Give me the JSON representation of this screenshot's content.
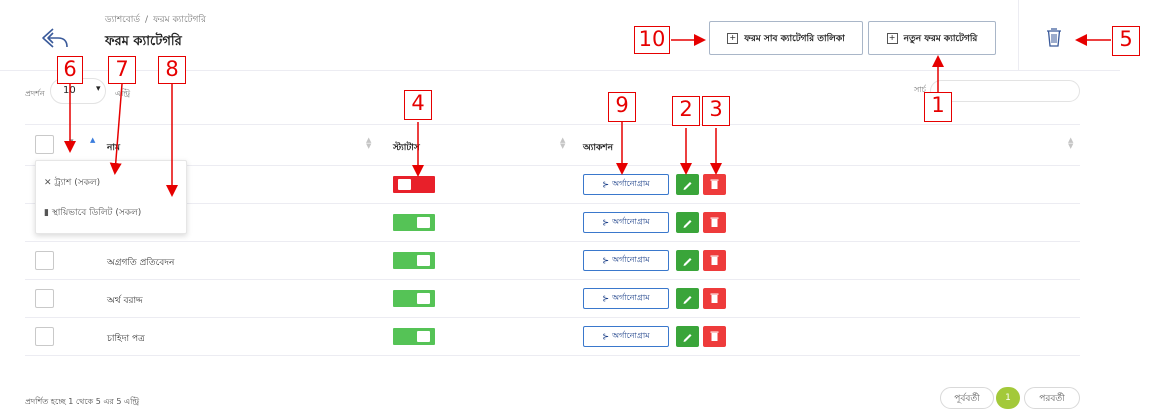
{
  "header": {
    "breadcrumb": [
      "ড্যাশবোর্ড",
      "ফরম ক্যাটেগরি"
    ],
    "breadcrumb_separator": "/",
    "title": "ফরম ক্যাটেগরি",
    "btn_subcategory_list": "ফরম সাব ক্যাটেগরি তালিকা",
    "btn_new_category": "নতুন ফরম ক্যাটেগরি",
    "back_icon": "back-arrow-icon",
    "trash_icon": "trash-icon"
  },
  "controls": {
    "show_label": "প্রদর্শন",
    "entries_value": "10",
    "entries_label": "এন্ট্রি",
    "search_label": "সার্চ",
    "search_value": ""
  },
  "table": {
    "columns": [
      "নাম",
      "স্ট্যাটাস",
      "অ্যাকশন"
    ],
    "rows": [
      {
        "name": "",
        "status": "off",
        "action_label": "অর্গানোগ্রাম"
      },
      {
        "name": "",
        "status": "on",
        "action_label": "অর্গানোগ্রাম"
      },
      {
        "name": "অগ্রগতি প্রতিবেদন",
        "status": "on",
        "action_label": "অর্গানোগ্রাম"
      },
      {
        "name": "অর্থ বরাদ্দ",
        "status": "on",
        "action_label": "অর্গানোগ্রাম"
      },
      {
        "name": "চাহিদা পত্র",
        "status": "on",
        "action_label": "অর্গানোগ্রাম"
      }
    ],
    "bulk_menu": [
      "✕ ট্র্যাশ (সকল)",
      "স্থায়িভাবে ডিলিট (সকল)"
    ]
  },
  "footer": {
    "info": "প্রদর্শিত হচ্ছে 1 থেকে 5 এর 5 এন্ট্রি",
    "prev": "পূর্ববর্তী",
    "current_page": "1",
    "next": "পরবর্তী"
  },
  "annotations": [
    "1",
    "2",
    "3",
    "4",
    "5",
    "6",
    "7",
    "8",
    "9",
    "10"
  ],
  "colors": {
    "toggle_on": "#55c356",
    "toggle_off": "#e8202a",
    "edit": "#3aa53a",
    "delete": "#ee3b3b",
    "pager_active": "#a3c93a",
    "annotation": "#e60000"
  }
}
